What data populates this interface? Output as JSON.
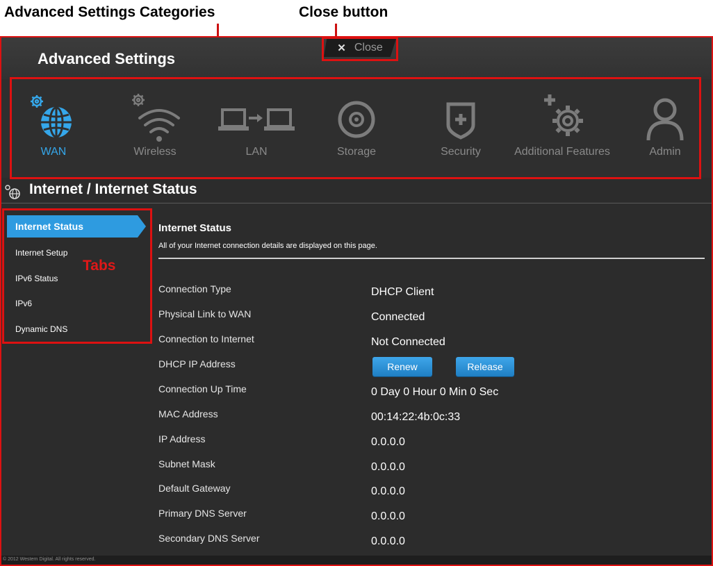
{
  "annotations": {
    "categories_label": "Advanced Settings Categories",
    "close_label": "Close button",
    "tabs_label": "Tabs"
  },
  "header": {
    "title": "Advanced Settings",
    "close": "Close"
  },
  "categories": [
    {
      "label": "WAN",
      "icon": "globe-icon",
      "active": true
    },
    {
      "label": "Wireless",
      "icon": "wifi-icon"
    },
    {
      "label": "LAN",
      "icon": "lan-icon"
    },
    {
      "label": "Storage",
      "icon": "storage-icon"
    },
    {
      "label": "Security",
      "icon": "shield-icon"
    },
    {
      "label": "Additional Features",
      "icon": "gear-plus-icon"
    },
    {
      "label": "Admin",
      "icon": "user-icon"
    }
  ],
  "section": {
    "title": "Internet / Internet Status"
  },
  "tabs": [
    {
      "label": "Internet Status",
      "active": true
    },
    {
      "label": "Internet Setup"
    },
    {
      "label": "IPv6 Status"
    },
    {
      "label": "IPv6"
    },
    {
      "label": "Dynamic DNS"
    }
  ],
  "content": {
    "title": "Internet Status",
    "subtitle": "All of your Internet connection details are displayed on this page.",
    "rows": [
      {
        "label": "Connection Type",
        "value": "DHCP Client"
      },
      {
        "label": "Physical Link to WAN",
        "value": "Connected"
      },
      {
        "label": "Connection to Internet",
        "value": "Not Connected"
      },
      {
        "label": "DHCP IP Address",
        "value": ""
      },
      {
        "label": "Connection Up Time",
        "value": "0 Day 0 Hour 0 Min 0 Sec"
      },
      {
        "label": "MAC Address",
        "value": "00:14:22:4b:0c:33"
      },
      {
        "label": "IP Address",
        "value": "0.0.0.0"
      },
      {
        "label": "Subnet Mask",
        "value": "0.0.0.0"
      },
      {
        "label": "Default Gateway",
        "value": "0.0.0.0"
      },
      {
        "label": "Primary DNS Server",
        "value": "0.0.0.0"
      },
      {
        "label": "Secondary DNS Server",
        "value": "0.0.0.0"
      }
    ],
    "renew_label": "Renew",
    "release_label": "Release"
  },
  "footer": {
    "copyright": "© 2012 Western Digital. All rights reserved."
  },
  "colors": {
    "accent": "#35a7ea",
    "annotation": "#dd1111",
    "background": "#2c2c2c"
  }
}
